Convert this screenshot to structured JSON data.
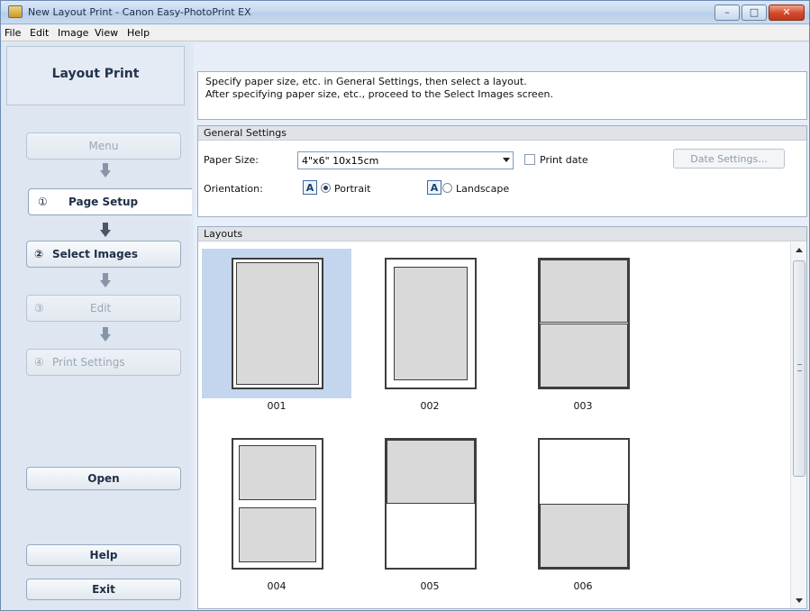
{
  "window": {
    "title": "New Layout Print - Canon Easy-PhotoPrint EX",
    "controls": {
      "minimize": "–",
      "maximize": "□",
      "close": "✕"
    }
  },
  "menubar": [
    "File",
    "Edit",
    "Image",
    "View",
    "Help"
  ],
  "sidebar": {
    "header": "Layout Print",
    "menu_button": "Menu",
    "steps": [
      {
        "num": "①",
        "label": "Page Setup"
      },
      {
        "num": "②",
        "label": "Select Images"
      },
      {
        "num": "③",
        "label": "Edit"
      },
      {
        "num": "④",
        "label": "Print Settings"
      }
    ],
    "open_button": "Open",
    "help_button": "Help",
    "exit_button": "Exit"
  },
  "instructions": [
    "Specify paper size, etc. in General Settings, then select a layout.",
    "After specifying paper size, etc., proceed to the Select Images screen."
  ],
  "general_settings": {
    "heading": "General Settings",
    "paper_size_label": "Paper Size:",
    "paper_size_value": "4\"x6\" 10x15cm",
    "print_date_label": "Print date",
    "print_date_checked": false,
    "date_settings_button": "Date Settings...",
    "orientation_label": "Orientation:",
    "orientation_icon_glyph": "A",
    "portrait_label": "Portrait",
    "landscape_label": "Landscape",
    "orientation_selected": "Portrait"
  },
  "layouts": {
    "heading": "Layouts",
    "selected": "001",
    "items": [
      "001",
      "002",
      "003",
      "004",
      "005",
      "006"
    ]
  },
  "colors": {
    "selection": "#c3d6ee",
    "sidebar_bg": "#dde6f1",
    "close_button": "#d2472a"
  }
}
